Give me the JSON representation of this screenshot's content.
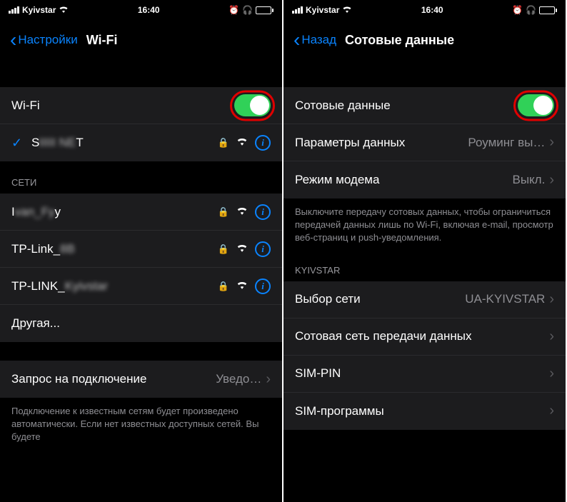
{
  "status": {
    "carrier": "Kyivstar",
    "time": "16:40"
  },
  "left": {
    "back": "Настройки",
    "title": "Wi-Fi",
    "wifiToggle": "Wi-Fi",
    "network": "S         T",
    "networksHeader": "СЕТИ",
    "nets": [
      "I         y",
      "TP-Link_    ",
      "TP-LINK_        "
    ],
    "other": "Другая...",
    "askRow": {
      "label": "Запрос на подключение",
      "value": "Уведо…"
    },
    "footer": "Подключение к известным сетям будет произведено автоматически. Если нет известных доступных сетей. Вы будете"
  },
  "right": {
    "back": "Назад",
    "title": "Сотовые данные",
    "cellToggle": "Сотовые данные",
    "rows1": [
      {
        "label": "Параметры данных",
        "value": "Роуминг вы…"
      },
      {
        "label": "Режим модема",
        "value": "Выкл."
      }
    ],
    "footer1": "Выключите передачу сотовых данных, чтобы ограничиться передачей данных лишь по Wi-Fi, включая e-mail, просмотр веб-страниц и push-уведомления.",
    "kyivHeader": "KYIVSTAR",
    "netSel": {
      "label": "Выбор сети",
      "value": "UA-KYIVSTAR"
    },
    "rows2": [
      "Сотовая сеть передачи данных",
      "SIM-PIN",
      "SIM-программы"
    ]
  }
}
